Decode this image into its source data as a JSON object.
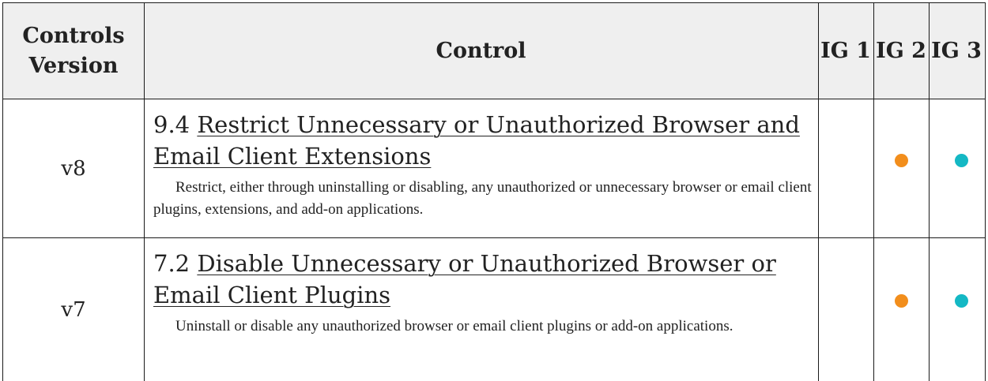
{
  "header": {
    "version": "Controls Version",
    "control": "Control",
    "ig1": "IG 1",
    "ig2": "IG 2",
    "ig3": "IG 3"
  },
  "colors": {
    "ig2_dot": "#f28e1c",
    "ig3_dot": "#14b8c4",
    "header_bg": "#efefef",
    "border": "#1a1a1a"
  },
  "rows": [
    {
      "version": "v8",
      "number": "9.4",
      "title": "Restrict Unnecessary or Unauthorized Browser and Email Client Extensions",
      "description": "Restrict, either through uninstalling or disabling, any unauthorized or unnecessary browser or email client plugins, extensions, and add-on applications.",
      "ig1": false,
      "ig2": true,
      "ig3": true
    },
    {
      "version": "v7",
      "number": "7.2",
      "title": "Disable Unnecessary or Unauthorized Browser or Email Client Plugins",
      "description": "Uninstall or disable any unauthorized browser or email client plugins or add-on applications.",
      "ig1": false,
      "ig2": true,
      "ig3": true
    }
  ]
}
